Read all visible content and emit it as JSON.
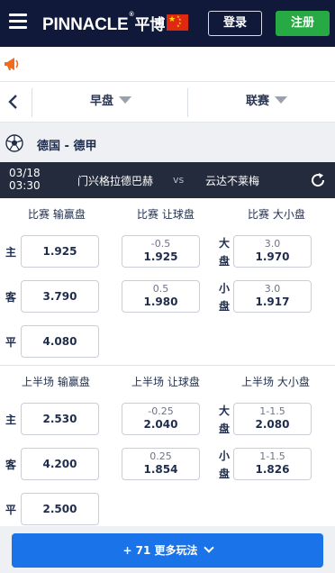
{
  "header": {
    "logo_text": "PINNACLE",
    "logo_reg": "®",
    "logo_cn": "平博",
    "login": "登录",
    "register": "注册",
    "flag_icon": "china-flag",
    "accent": "#10193a",
    "register_color": "#27a944"
  },
  "filters": {
    "back_icon": "chevron-left-icon",
    "period": "早盘",
    "sort": "联赛"
  },
  "league": {
    "icon": "soccer-ball-icon",
    "name": "德国 - 德甲"
  },
  "match": {
    "date": "03/18",
    "time": "03:30",
    "home": "门兴格拉德巴赫",
    "vs": "vs",
    "away": "云达不莱梅"
  },
  "full_time": {
    "headers": [
      "比赛 输赢盘",
      "比赛 让球盘",
      "比赛 大小盘"
    ],
    "moneyline": [
      {
        "label": "主",
        "odds": "1.925"
      },
      {
        "label": "客",
        "odds": "3.790"
      },
      {
        "label": "平",
        "odds": "4.080"
      }
    ],
    "handicap": [
      {
        "line": "-0.5",
        "odds": "1.925"
      },
      {
        "line": "0.5",
        "odds": "1.980"
      }
    ],
    "totals": [
      {
        "label": "大盘",
        "line": "3.0",
        "odds": "1.970"
      },
      {
        "label": "小盘",
        "line": "3.0",
        "odds": "1.917"
      }
    ]
  },
  "first_half": {
    "headers": [
      "上半场 输赢盘",
      "上半场 让球盘",
      "上半场 大小盘"
    ],
    "moneyline": [
      {
        "label": "主",
        "odds": "2.530"
      },
      {
        "label": "客",
        "odds": "4.200"
      },
      {
        "label": "平",
        "odds": "2.500"
      }
    ],
    "handicap": [
      {
        "line": "-0.25",
        "odds": "2.040"
      },
      {
        "line": "0.25",
        "odds": "1.854"
      }
    ],
    "totals": [
      {
        "label": "大盘",
        "line": "1-1.5",
        "odds": "2.080"
      },
      {
        "label": "小盘",
        "line": "1-1.5",
        "odds": "1.826"
      }
    ]
  },
  "more": {
    "label": "+ 71 更多玩法",
    "button_color": "#1a73e8"
  }
}
